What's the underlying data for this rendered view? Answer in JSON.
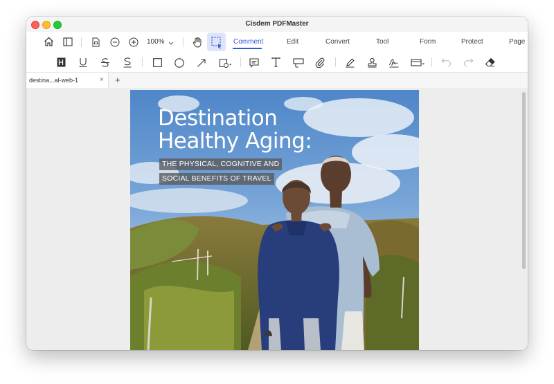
{
  "app": {
    "title": "Cisdem PDFMaster"
  },
  "toolbar": {
    "zoom": "100%",
    "tabs": [
      "Comment",
      "Edit",
      "Convert",
      "Tool",
      "Form",
      "Protect",
      "Page"
    ],
    "active_tab": "Comment"
  },
  "document_tab": {
    "label": "destina...al-web-1",
    "close": "×",
    "add": "+"
  },
  "page": {
    "title_line1": "Destination",
    "title_line2": "Healthy Aging:",
    "subtitle_line1": "THE PHYSICAL, COGNITIVE AND",
    "subtitle_line2": "SOCIAL BENEFITS OF TRAVEL"
  },
  "colors": {
    "accent": "#2f5bd8",
    "selected_tool": "#dfe4fb"
  }
}
